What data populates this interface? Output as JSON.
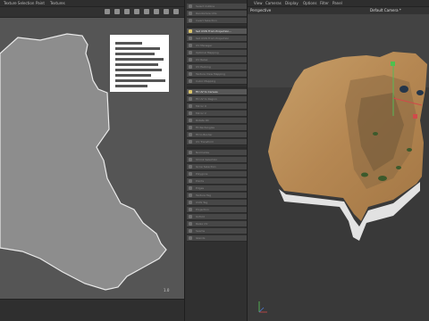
{
  "uv_editor": {
    "menu": [
      "Texture Selection",
      "Paint",
      "Textures"
    ],
    "coord_label": "1.0"
  },
  "tools": {
    "items": [
      {
        "label": "Select Outline",
        "highlight": false
      },
      {
        "label": "Randomize UVs",
        "highlight": false
      },
      {
        "label": "Invert Selection",
        "highlight": false
      },
      {
        "label": "Set UVW From Projection...",
        "highlight": true
      },
      {
        "label": "Set UVW From Projection",
        "highlight": false
      },
      {
        "label": "UV Manager",
        "highlight": false
      },
      {
        "label": "Optimal Mapping",
        "highlight": false
      },
      {
        "label": "UV Relax",
        "highlight": false
      },
      {
        "label": "UV Packing",
        "highlight": false
      },
      {
        "label": "Texture View Mapping",
        "highlight": false
      },
      {
        "label": "Cubic Mapping",
        "highlight": false
      },
      {
        "label": "Fit UV to Canvas",
        "highlight": true
      },
      {
        "label": "Fit UV to Region",
        "highlight": false
      },
      {
        "label": "Mirror U",
        "highlight": false
      },
      {
        "label": "Mirror V",
        "highlight": false
      },
      {
        "label": "Rotate 90",
        "highlight": false
      },
      {
        "label": "Fit Rectangles",
        "highlight": false
      },
      {
        "label": "Fit to Border",
        "highlight": false
      },
      {
        "label": "UV Transform",
        "highlight": false
      },
      {
        "label": "Normalize",
        "highlight": false
      },
      {
        "label": "Shrink Selection",
        "highlight": false
      },
      {
        "label": "Grow Selection",
        "highlight": false
      },
      {
        "label": "Polygons",
        "highlight": false
      },
      {
        "label": "Points",
        "highlight": false
      },
      {
        "label": "Edges",
        "highlight": false
      },
      {
        "label": "Texture Tag",
        "highlight": false
      },
      {
        "label": "UVW Tag",
        "highlight": false
      },
      {
        "label": "Projection",
        "highlight": false
      },
      {
        "label": "Unfold",
        "highlight": false
      },
      {
        "label": "Relax UV",
        "highlight": false
      },
      {
        "label": "Seams",
        "highlight": false
      },
      {
        "label": "Islands",
        "highlight": false
      }
    ]
  },
  "viewport": {
    "menu": [
      "View",
      "Cameras",
      "Display",
      "Options",
      "Filter",
      "Panel"
    ],
    "view_name": "Perspective",
    "camera": "Default Camera *"
  }
}
